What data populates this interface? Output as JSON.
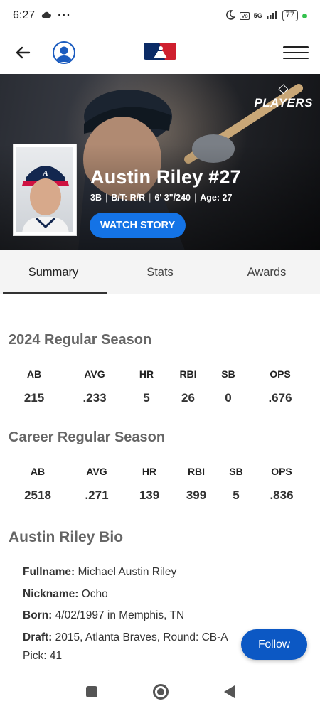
{
  "status_bar": {
    "time": "6:27",
    "battery": "77",
    "network": "5G"
  },
  "player": {
    "name": "Austin Riley #27",
    "position": "3B",
    "bats_throws": "B/T: R/R",
    "height_weight": "6' 3\"/240",
    "age": "Age: 27",
    "badge": "PLAYERS"
  },
  "hero": {
    "watch_label": "WATCH STORY"
  },
  "tabs": [
    {
      "label": "Summary"
    },
    {
      "label": "Stats"
    },
    {
      "label": "Awards"
    }
  ],
  "season": {
    "title": "2024 Regular Season",
    "headers": [
      "AB",
      "AVG",
      "HR",
      "RBI",
      "SB",
      "OPS"
    ],
    "values": [
      "215",
      ".233",
      "5",
      "26",
      "0",
      ".676"
    ]
  },
  "career": {
    "title": "Career Regular Season",
    "headers": [
      "AB",
      "AVG",
      "HR",
      "RBI",
      "SB",
      "OPS"
    ],
    "values": [
      "2518",
      ".271",
      "139",
      "399",
      "5",
      ".836"
    ]
  },
  "bio": {
    "title": "Austin Riley Bio",
    "fullname_label": "Fullname:",
    "fullname": "Michael Austin Riley",
    "nickname_label": "Nickname:",
    "nickname": "Ocho",
    "born_label": "Born:",
    "born": "4/02/1997 in Memphis, TN",
    "draft_label": "Draft:",
    "draft": "2015, Atlanta Braves, Round: CB-A",
    "pick": "Pick: 41"
  },
  "follow_label": "Follow",
  "colors": {
    "accent": "#1473e6",
    "follow": "#0c58c4",
    "profile": "#1a5bbf"
  }
}
